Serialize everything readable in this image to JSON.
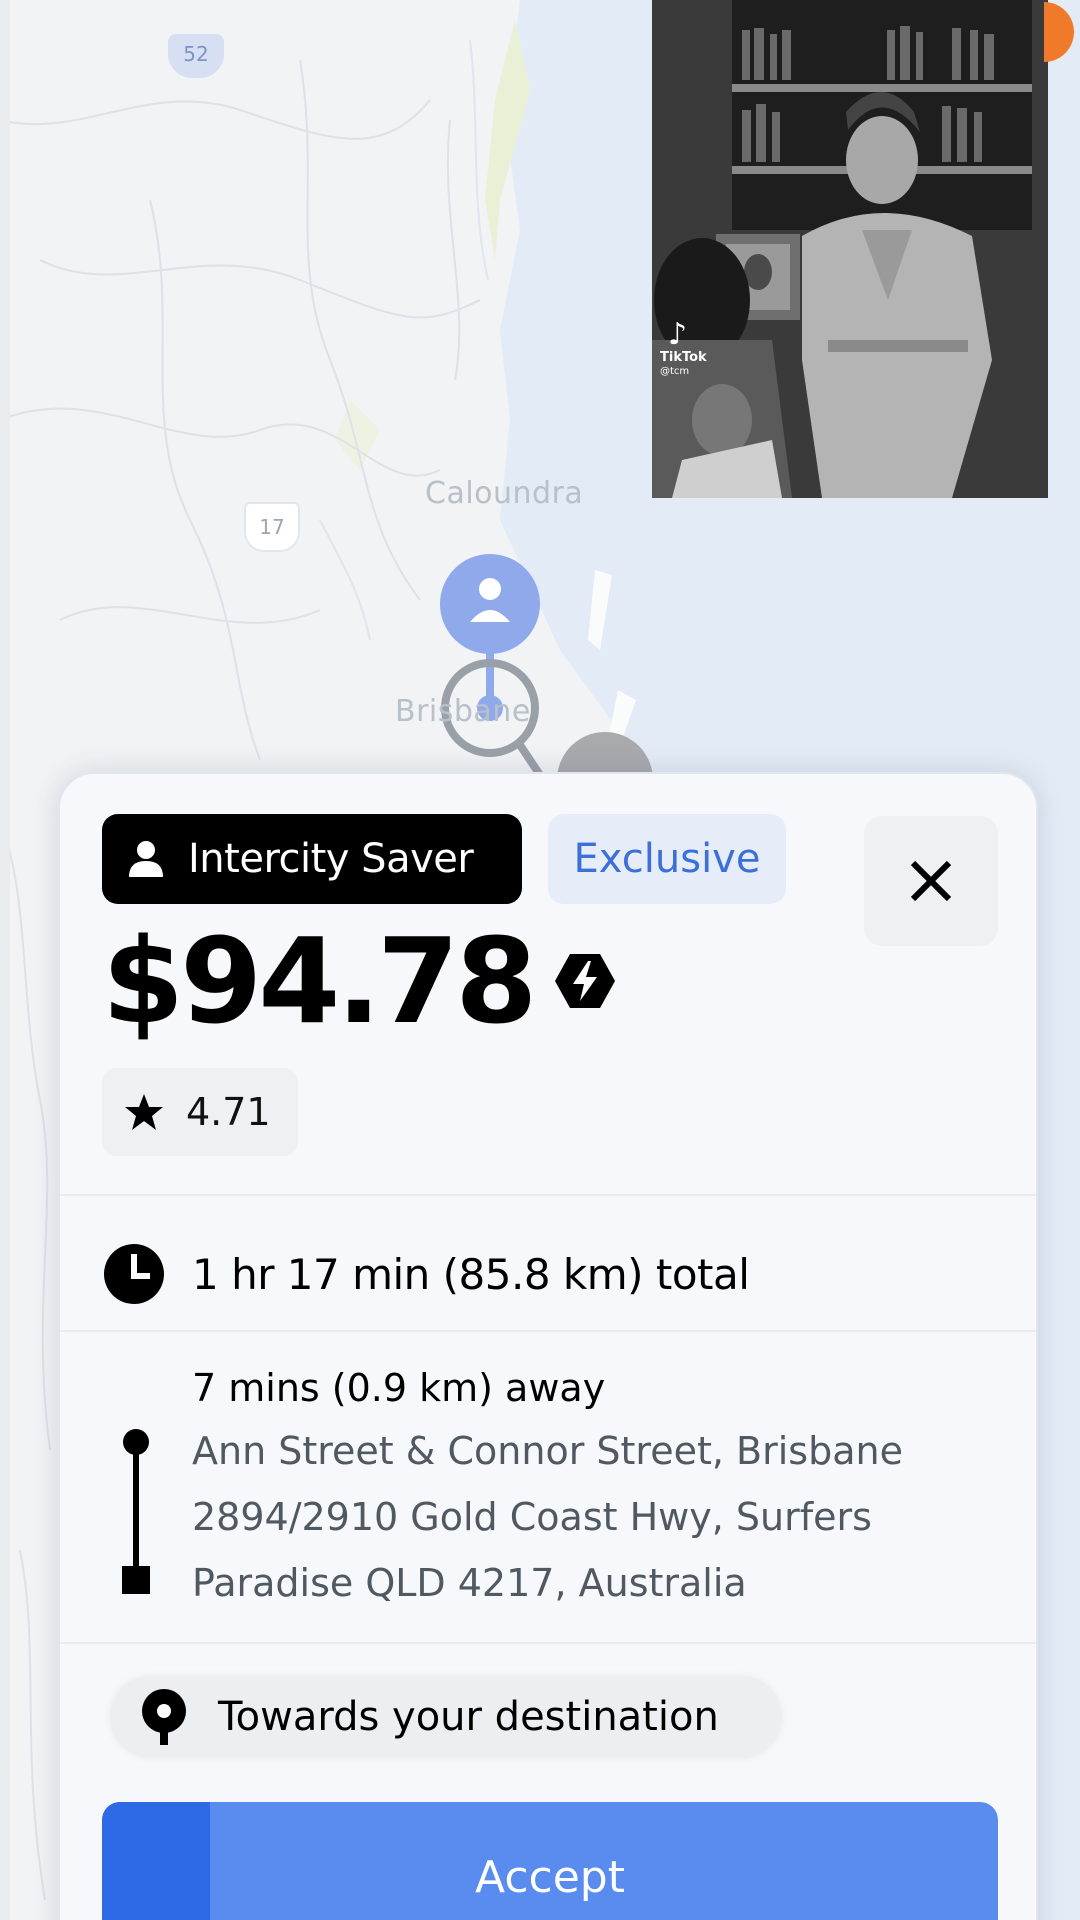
{
  "map": {
    "place_labels": [
      "Caloundra",
      "Brisbane"
    ],
    "route_shields": [
      "52",
      "17"
    ]
  },
  "video": {
    "brand": "TikTok",
    "handle": "@tcm"
  },
  "offer": {
    "service_type": "Intercity Saver",
    "exclusive_label": "Exclusive",
    "price": "$94.78",
    "rating": "4.71",
    "trip_total": "1 hr 17 min (85.8 km) total",
    "pickup_eta": "7 mins (0.9 km) away",
    "pickup_address": "Ann Street & Connor Street, Brisbane",
    "dropoff_address_line1": "2894/2910 Gold Coast Hwy, Surfers",
    "dropoff_address_line2": "Paradise QLD 4217, Australia",
    "destination_hint": "Towards your destination",
    "accept_label": "Accept",
    "accept_progress": 0.12
  },
  "colors": {
    "accent": "#5a8bee",
    "accent_dark": "#2e6ae6",
    "exclusive_text": "#3b70d8",
    "map_pin": "#8fa9ea"
  },
  "icons": {
    "service": "person-icon",
    "close": "close-icon",
    "surge": "surge-icon",
    "rating": "star-icon",
    "duration": "clock-icon",
    "route": "route-line-icon",
    "destination": "location-pin-icon"
  }
}
